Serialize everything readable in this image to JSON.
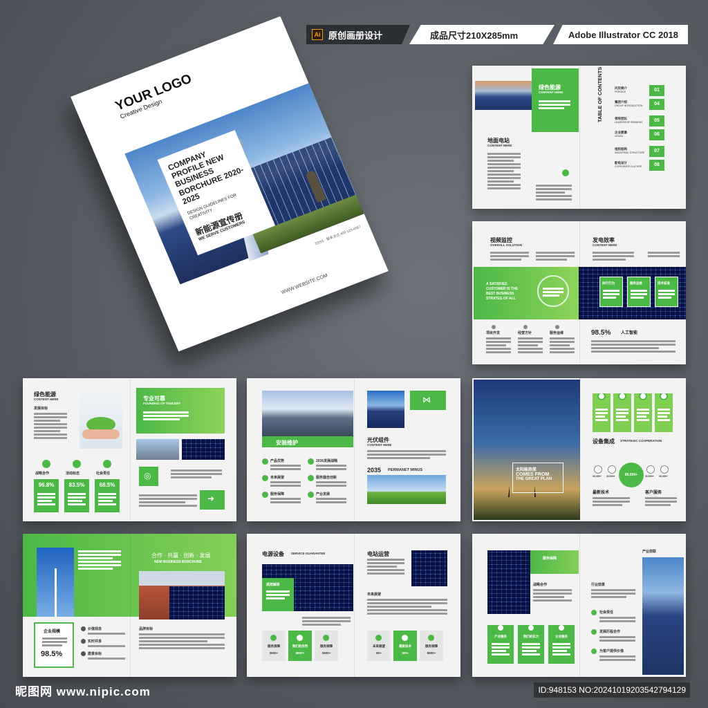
{
  "tags": {
    "tag1": "原创画册设计",
    "ai_badge": "Ai",
    "tag2": "成品尺寸210X285mm",
    "tag3": "Adobe Illustrator CC 2018"
  },
  "cover": {
    "logo": "YOUR LOGO",
    "logo_sub": "Creative Design",
    "title": "COMPANY PROFILE NEW BUSINESS BORCHURE 2020-2025",
    "guide": "DESIGN GUIDELINES FOR CREATIVITY",
    "cn_title": "新能源宣传册",
    "cn_sub": "WE SERVE CUSTOMERS",
    "website": "WWW.WEBSITE.COM",
    "contact": "SSSS · 联系方式 400-123-4567"
  },
  "spread1": {
    "green_cn": "绿色能源",
    "green_en": "CONTENT HERE",
    "ground_cn": "地面电站",
    "ground_en": "CONTENT HERE",
    "toc_title": "TABLE OF CONTENTS",
    "toc": [
      {
        "num": "01",
        "cn": "内页简介",
        "en": "PREFACE"
      },
      {
        "num": "04",
        "cn": "集团介绍",
        "en": "GROUP INTRODUCTION"
      },
      {
        "num": "05",
        "cn": "领导团队",
        "en": "LEADERSHIP REMARKS"
      },
      {
        "num": "06",
        "cn": "企业愿景",
        "en": "VISION"
      },
      {
        "num": "07",
        "cn": "组织结构",
        "en": "INDUSTRIAL STRUCTURE"
      },
      {
        "num": "08",
        "cn": "配电设计",
        "en": "CORPORATE CULTURE"
      }
    ]
  },
  "spread2": {
    "video_cn": "视频监控",
    "video_en": "OVERALL SOLUTION",
    "power_cn": "发电效率",
    "power_en": "CONTENT HERE",
    "quote": "A SATISFIED CUSTOMER IS THE BEST BUSINESS STRATEG OF ALL",
    "boxes": [
      "执行行为",
      "服务运维",
      "技术标准"
    ],
    "items": [
      "项目开发",
      "经营方针",
      "服务运维"
    ],
    "stat": "98.5%",
    "stat_label": "人工智能"
  },
  "spread3": {
    "green_cn": "绿色能源",
    "green_en": "CONTENT HERE",
    "goal": "发展目标",
    "pro_cn": "专业可靠",
    "pro_en": "FOUNDING OF TENCENT",
    "stats": [
      {
        "label": "战略合作",
        "val": "96.8%"
      },
      {
        "label": "活动标志",
        "val": "83.5%"
      },
      {
        "label": "社会责任",
        "val": "68.5%"
      }
    ]
  },
  "spread4": {
    "install": "安装维护",
    "pv_cn": "光伏组件",
    "pv_en": "CONTENT HERE",
    "year": "2035",
    "year_en": "PERMANET MINUS",
    "items": [
      "产品优势",
      "2036发展战略",
      "未来展望",
      "服务器自创新",
      "服务保障",
      "产业发展"
    ]
  },
  "spread5": {
    "overlay1": "太阳能热泵",
    "overlay2": "COMES FROM",
    "overlay3": "THE GREAT PLAN",
    "coop_cn": "设备集成",
    "coop_en": "STRATEGIC COOPERATION",
    "center_val": "85,000+",
    "nodes": [
      "30,000+",
      "30,000+",
      "30,000+",
      "30,000+"
    ],
    "labels": [
      "最新技术",
      "客户服务"
    ]
  },
  "spread6": {
    "slogan": "合作 · 共赢 · 创新 · 发展",
    "slogan_en": "NEW BUSINESS BORCHURE",
    "biz": "企业规模",
    "biz_val": "98.5%",
    "list": [
      "价值观念",
      "实时共享",
      "愿景目标"
    ],
    "brand": "品牌目标"
  },
  "spread7": {
    "title1": "电源设备",
    "title1_en": "SERVICE GUARANTEE",
    "title2": "电站运营",
    "ribbon": "高效解析",
    "future": "未来展望",
    "tiles1": [
      {
        "label": "服务保障",
        "val": "3600+"
      },
      {
        "label": "我们的优势",
        "val": "8800+"
      },
      {
        "label": "服务保障",
        "val": "2900+"
      }
    ],
    "tiles2": [
      {
        "label": "未来展望",
        "val": "80+"
      },
      {
        "label": "最新技术",
        "val": "98%"
      },
      {
        "label": "服务保障",
        "val": "8900+"
      }
    ]
  },
  "spread8": {
    "service": "服务保障",
    "coop": "战略合作",
    "outlook": "行业前景",
    "industry": "产业前联",
    "tiles": [
      "产业服务",
      "我们的实力",
      "企业服务"
    ],
    "right_items": [
      "社会责任",
      "发展历程合作",
      "为客户提供价值"
    ]
  },
  "watermark": {
    "left": "昵图网 www.nipic.com",
    "right": "ID:948153 NO:20241019203542794129"
  }
}
